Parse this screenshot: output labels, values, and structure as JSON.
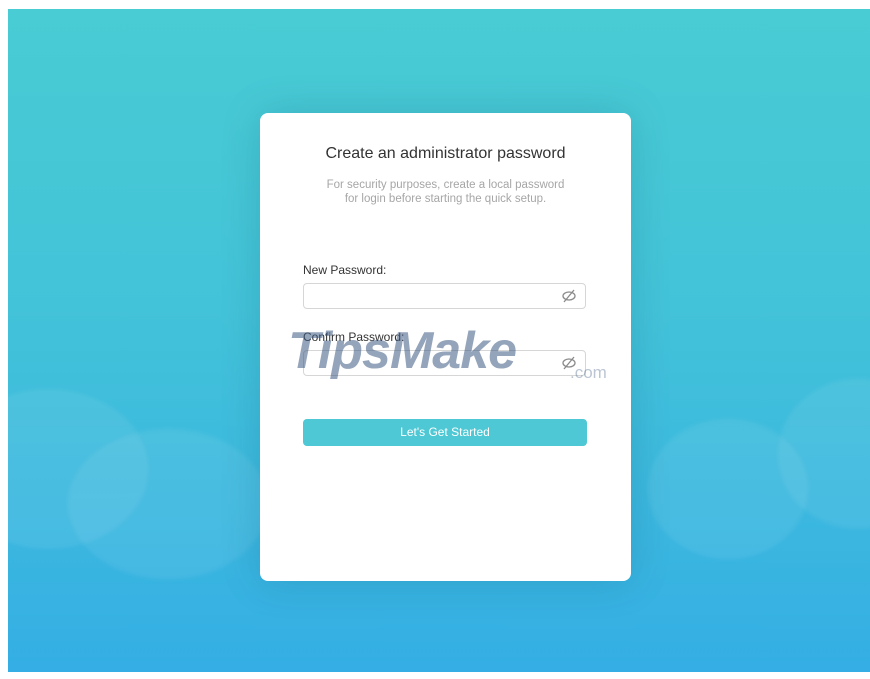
{
  "dialog": {
    "title": "Create an administrator password",
    "subtitle_line1": "For security purposes, create a local password",
    "subtitle_line2": "for login before starting the quick setup.",
    "new_password": {
      "label": "New Password:",
      "value": "",
      "icon": "eye-off-icon"
    },
    "confirm_password": {
      "label": "Confirm Password:",
      "value": "",
      "icon": "eye-off-icon"
    },
    "submit_label": "Let's Get Started"
  },
  "watermark": {
    "brand": "TipsMake",
    "suffix": ".com"
  },
  "colors": {
    "background_top": "#49ccd3",
    "background_bottom": "#34aee4",
    "button": "#4dc8d4",
    "card": "#ffffff"
  }
}
